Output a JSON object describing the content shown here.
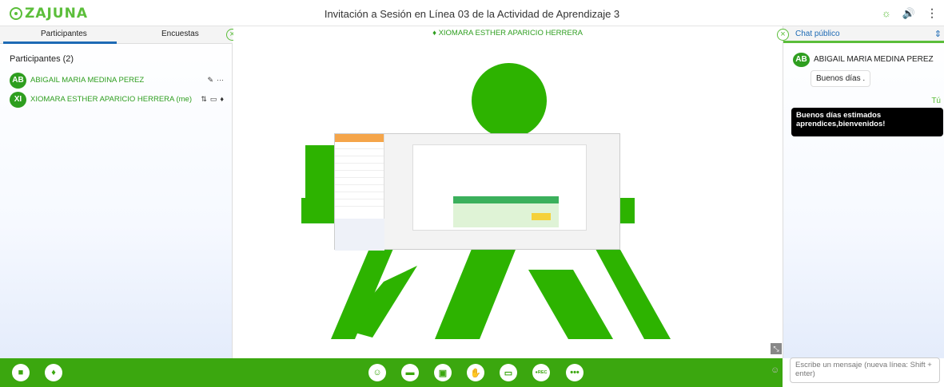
{
  "header": {
    "logo_text": "ZAJUNA",
    "title": "Invitación a Sesión en Línea 03 de la Actividad de Aprendizaje 3",
    "icons": [
      "sun-icon",
      "speaker-icon",
      "kebab-menu-icon"
    ]
  },
  "left_panel": {
    "tabs": [
      {
        "label": "Participantes",
        "active": true
      },
      {
        "label": "Encuestas",
        "active": false
      }
    ],
    "heading": "Participantes (2)",
    "participants": [
      {
        "initials": "AB",
        "name": "ABIGAIL MARIA MEDINA PEREZ"
      },
      {
        "initials": "XI",
        "name": "XIOMARA ESTHER APARICIO HERRERA (me)"
      }
    ]
  },
  "stage": {
    "presenter": "XIOMARA ESTHER APARICIO HERRERA",
    "presenter_icon": "microphone-icon"
  },
  "chat": {
    "title": "Chat público",
    "messages": [
      {
        "sender_initials": "AB",
        "sender": "ABIGAIL MARIA MEDINA PEREZ",
        "text": "Buenos días ."
      }
    ],
    "you_label": "Tú",
    "my_message": "Buenos días estimados aprendices,bienvenidos!",
    "input_placeholder": "Escribe un mensaje (nueva línea: Shift + enter)"
  },
  "toolbar": {
    "left_buttons": [
      "camera-icon",
      "microphone-icon"
    ],
    "center_buttons": [
      "user-raise-icon",
      "chat-icon",
      "screen-share-icon",
      "hand-icon",
      "presentation-icon",
      "record-icon",
      "more-icon"
    ],
    "record_label": "●REC"
  },
  "colors": {
    "brand_green": "#3ba70f",
    "accent_blue": "#1e6ab5",
    "sena_green": "#2db300"
  }
}
